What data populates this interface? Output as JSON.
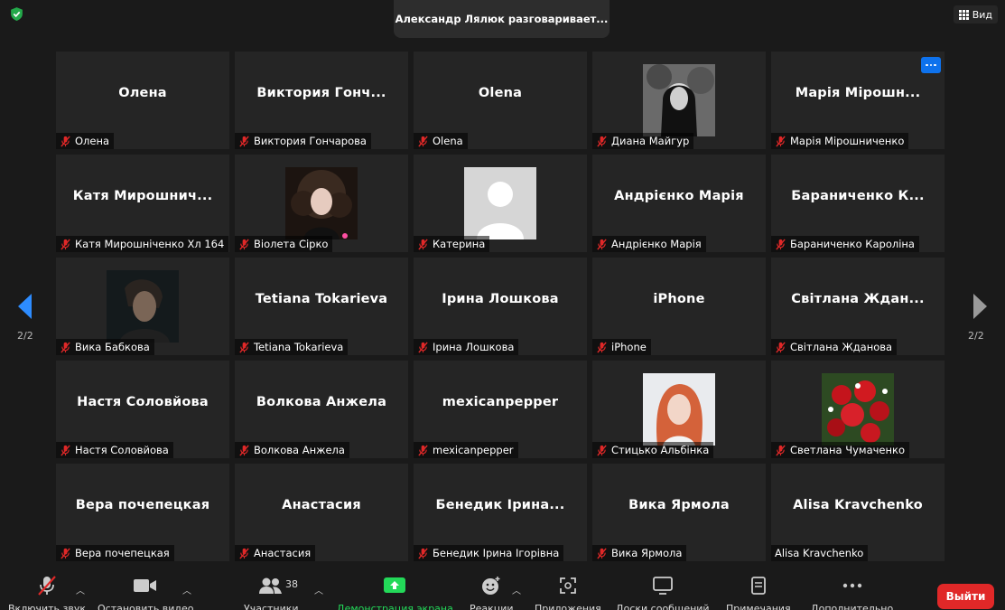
{
  "header": {
    "speaker_banner": "Александр Лялюк разговаривает...",
    "view_label": "Вид"
  },
  "pagination": {
    "left": "2/2",
    "right": "2/2"
  },
  "participants": [
    {
      "display": "Олена",
      "label": "Олена",
      "muted": true
    },
    {
      "display": "Виктория Гонч...",
      "label": "Виктория Гончарова",
      "muted": true
    },
    {
      "display": "Olena",
      "label": "Olena",
      "muted": true
    },
    {
      "display": "",
      "label": "Диана Майгур",
      "muted": true,
      "avatar": "bw-portrait"
    },
    {
      "display": "Марія Мірошн...",
      "label": "Марія Мірошниченко",
      "muted": true,
      "menu": true
    },
    {
      "display": "Катя Мирошнич...",
      "label": "Катя Мирошніченко Хл 164",
      "muted": true
    },
    {
      "display": "",
      "label": "Віолета Сірко",
      "muted": true,
      "avatar": "dark-curly"
    },
    {
      "display": "",
      "label": "Катерина",
      "muted": true,
      "avatar": "default-user"
    },
    {
      "display": "Андрієнко Марія",
      "label": "Андрієнко Марія",
      "muted": true
    },
    {
      "display": "Бараниченко К...",
      "label": "Бараниченко Кароліна",
      "muted": true
    },
    {
      "display": "",
      "label": "Вика Бабкова",
      "muted": true,
      "avatar": "dark-man"
    },
    {
      "display": "Tetiana Tokarieva",
      "label": "Tetiana Tokarieva",
      "muted": true
    },
    {
      "display": "Ірина Лошкова",
      "label": "Ірина Лошкова",
      "muted": true
    },
    {
      "display": "iPhone",
      "label": "iPhone",
      "muted": true
    },
    {
      "display": "Світлана Ждан...",
      "label": "Світлана Жданова",
      "muted": true
    },
    {
      "display": "Настя Соловйова",
      "label": "Настя Соловйова",
      "muted": true
    },
    {
      "display": "Волкова Анжела",
      "label": "Волкова Анжела",
      "muted": true
    },
    {
      "display": "mexicanpepper",
      "label": "mexicanpepper",
      "muted": true
    },
    {
      "display": "",
      "label": "Стицько Альбінка",
      "muted": true,
      "avatar": "redhead"
    },
    {
      "display": "",
      "label": "Светлана Чумаченко",
      "muted": true,
      "avatar": "roses"
    },
    {
      "display": "Вера почепецкая",
      "label": "Вера почепецкая",
      "muted": true
    },
    {
      "display": "Анастасия",
      "label": "Анастасия",
      "muted": true
    },
    {
      "display": "Бенедик Ірина...",
      "label": "Бенедик Ірина Ігорівна",
      "muted": true
    },
    {
      "display": "Вика Ярмола",
      "label": "Вика Ярмола",
      "muted": true
    },
    {
      "display": "Alisa Kravchenko",
      "label": "Alisa Kravchenko",
      "muted": false
    }
  ],
  "toolbar": {
    "unmute": "Включить звук",
    "stop_video": "Остановить видео",
    "participants": "Участники",
    "participants_count": "38",
    "share": "Демонстрация экрана",
    "reactions": "Реакции",
    "apps": "Приложения",
    "whiteboards": "Доски сообщений",
    "notes": "Примечания",
    "more": "Дополнительно",
    "leave": "Выйти"
  },
  "colors": {
    "background": "#1a1a1a",
    "tile": "#252525",
    "share_green": "#23d959",
    "leave_red": "#e02828",
    "mute_red": "#e02828",
    "accent_blue": "#0e72ed"
  }
}
